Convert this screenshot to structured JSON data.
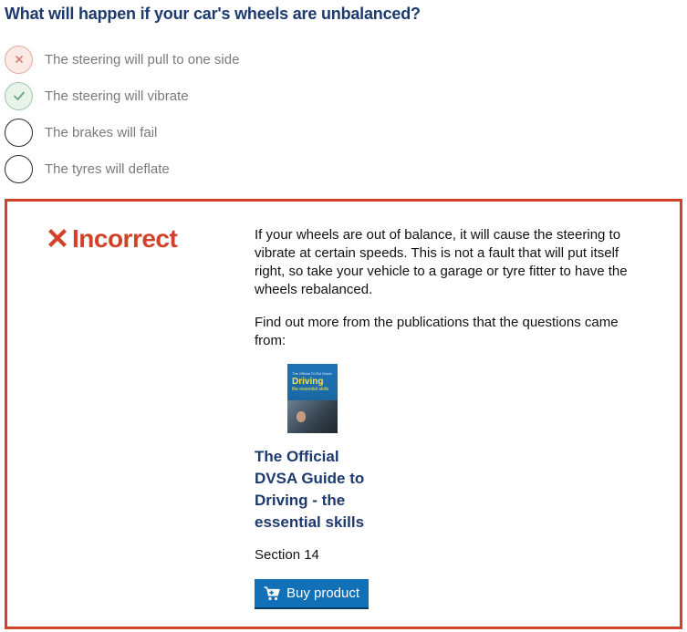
{
  "question": {
    "text": "What will happen if your car's wheels are unbalanced?"
  },
  "options": [
    {
      "label": "The steering will pull to one side",
      "state": "wrong",
      "icon": "cross-icon"
    },
    {
      "label": "The steering will vibrate",
      "state": "correct",
      "icon": "check-icon"
    },
    {
      "label": "The brakes will fail",
      "state": "none"
    },
    {
      "label": "The tyres will deflate",
      "state": "none"
    }
  ],
  "feedback": {
    "verdict": "Incorrect",
    "verdict_icon": "cross-icon",
    "explanation": "If your wheels are out of balance, it will cause the steering to vibrate at certain speeds. This is not a fault that will put itself right, so take your vehicle to a garage or tyre fitter to have the wheels rebalanced.",
    "more_info": "Find out more from the publications that the questions came from:",
    "publication": {
      "cover_text_small": "The Official DVSA Guide",
      "cover_text_title": "Driving",
      "cover_text_sub": "the essential skills",
      "title": "The Official DVSA Guide to Driving - the essential skills",
      "section": "Section 14",
      "buy_label": "Buy product",
      "buy_icon": "cart-icon"
    }
  },
  "colors": {
    "heading": "#1d3a6e",
    "incorrect": "#d2422a",
    "button": "#1270b8"
  }
}
